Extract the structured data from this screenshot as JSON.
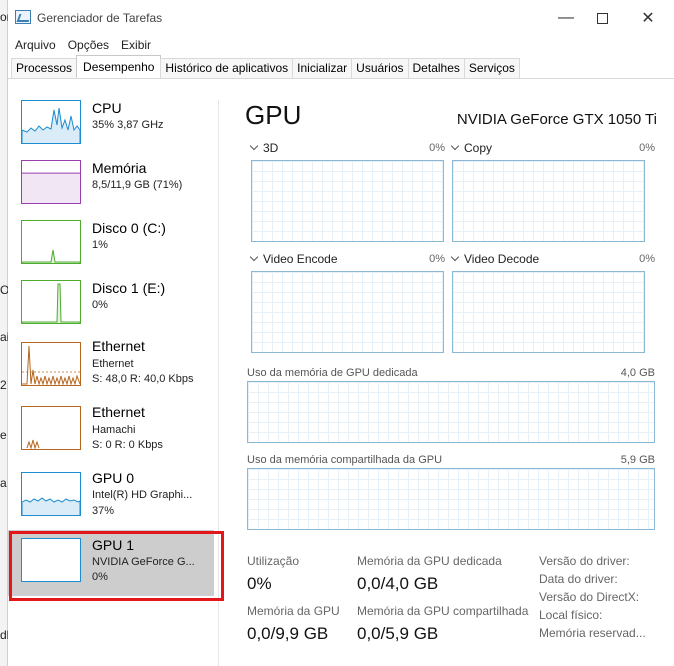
{
  "window": {
    "title": "Gerenciador de Tarefas",
    "app_icon": "task-manager-icon"
  },
  "menu": [
    "Arquivo",
    "Opções",
    "Exibir"
  ],
  "tabs": [
    {
      "label": "Processos",
      "active": false
    },
    {
      "label": "Desempenho",
      "active": true
    },
    {
      "label": "Histórico de aplicativos",
      "active": false
    },
    {
      "label": "Inicializar",
      "active": false
    },
    {
      "label": "Usuários",
      "active": false
    },
    {
      "label": "Detalhes",
      "active": false
    },
    {
      "label": "Serviços",
      "active": false
    }
  ],
  "sidebar": {
    "items": [
      {
        "name": "CPU",
        "line1": "35%  3,87 GHz",
        "line2": "",
        "color": "#1e8cd0",
        "selected": false
      },
      {
        "name": "Memória",
        "line1": "8,5/11,9 GB (71%)",
        "line2": "",
        "color": "#9b3fb0",
        "selected": false,
        "fill_fraction": 0.71
      },
      {
        "name": "Disco 0 (C:)",
        "line1": "1%",
        "line2": "",
        "color": "#4dab2e",
        "selected": false
      },
      {
        "name": "Disco 1 (E:)",
        "line1": "0%",
        "line2": "",
        "color": "#4dab2e",
        "selected": false
      },
      {
        "name": "Ethernet",
        "line1": "Ethernet",
        "line2": "S: 48,0  R: 40,0 Kbps",
        "color": "#b5651d",
        "selected": false
      },
      {
        "name": "Ethernet",
        "line1": "Hamachi",
        "line2": "S: 0  R: 0 Kbps",
        "color": "#b5651d",
        "selected": false
      },
      {
        "name": "GPU 0",
        "line1": "Intel(R) HD Graphi...",
        "line2": "37%",
        "color": "#1e8cd0",
        "selected": false
      },
      {
        "name": "GPU 1",
        "line1": "NVIDIA GeForce G...",
        "line2": "0%",
        "color": "#1e8cd0",
        "selected": true
      }
    ]
  },
  "main": {
    "title": "GPU",
    "model": "NVIDIA GeForce GTX 1050 Ti",
    "engines": [
      {
        "label": "3D",
        "pct": "0%"
      },
      {
        "label": "Copy",
        "pct": "0%"
      },
      {
        "label": "Video Encode",
        "pct": "0%"
      },
      {
        "label": "Video Decode",
        "pct": "0%"
      }
    ],
    "memory_graphs": [
      {
        "label": "Uso da memória de GPU dedicada",
        "value": "4,0 GB"
      },
      {
        "label": "Uso da memória compartilhada da GPU",
        "value": "5,9 GB"
      }
    ],
    "stats": {
      "util_label": "Utilização",
      "util_value": "0%",
      "dedicated_label": "Memória da GPU dedicada",
      "dedicated_value": "0,0/4,0 GB",
      "gpumem_label": "Memória da GPU",
      "gpumem_value": "0,0/9,9 GB",
      "shared_label": "Memória da GPU compartilhada",
      "shared_value": "0,0/5,9 GB"
    },
    "info_labels": [
      "Versão do driver:",
      "Data do driver:",
      "Versão do DirectX:",
      "Local físico:",
      "Memória reservad..."
    ]
  },
  "left_edge": [
    "or",
    "O",
    "ai",
    "2",
    "e",
    "a",
    "dl"
  ]
}
